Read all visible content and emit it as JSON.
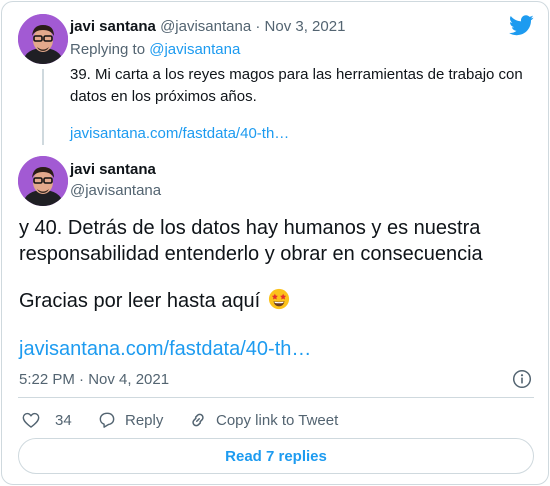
{
  "parent_tweet": {
    "author_name": "javi santana",
    "author_handle": "@javisantana",
    "separator": "·",
    "date": "Nov 3, 2021",
    "replying_to_label": "Replying to ",
    "replying_to_handle": "@javisantana",
    "text": "39. Mi carta a los reyes magos para las herramientas de trabajo con datos en los próximos años.",
    "link": "javisantana.com/fastdata/40-th…"
  },
  "main_tweet": {
    "author_name": "javi santana",
    "author_handle": "@javisantana",
    "text_line1": "y 40. Detrás de los datos hay humanos y es nuestra responsabilidad entenderlo y obrar en consecuencia",
    "text_line2": "Gracias por leer hasta aquí",
    "link": "javisantana.com/fastdata/40-th…",
    "timestamp": "5:22 PM · Nov 4, 2021"
  },
  "actions": {
    "like_count": "34",
    "reply_label": "Reply",
    "copy_label": "Copy link to Tweet"
  },
  "read_replies_label": "Read 7 replies",
  "icons": {
    "logo": "twitter-bird-icon",
    "info": "info-icon",
    "like": "heart-icon",
    "reply": "speech-bubble-icon",
    "copy": "link-icon",
    "emoji": "star-struck-emoji"
  },
  "colors": {
    "accent": "#1d9bf0",
    "text": "#0f1419",
    "muted": "#536471",
    "border": "#cfd9de",
    "avatar_bg": "#a25ad3"
  }
}
